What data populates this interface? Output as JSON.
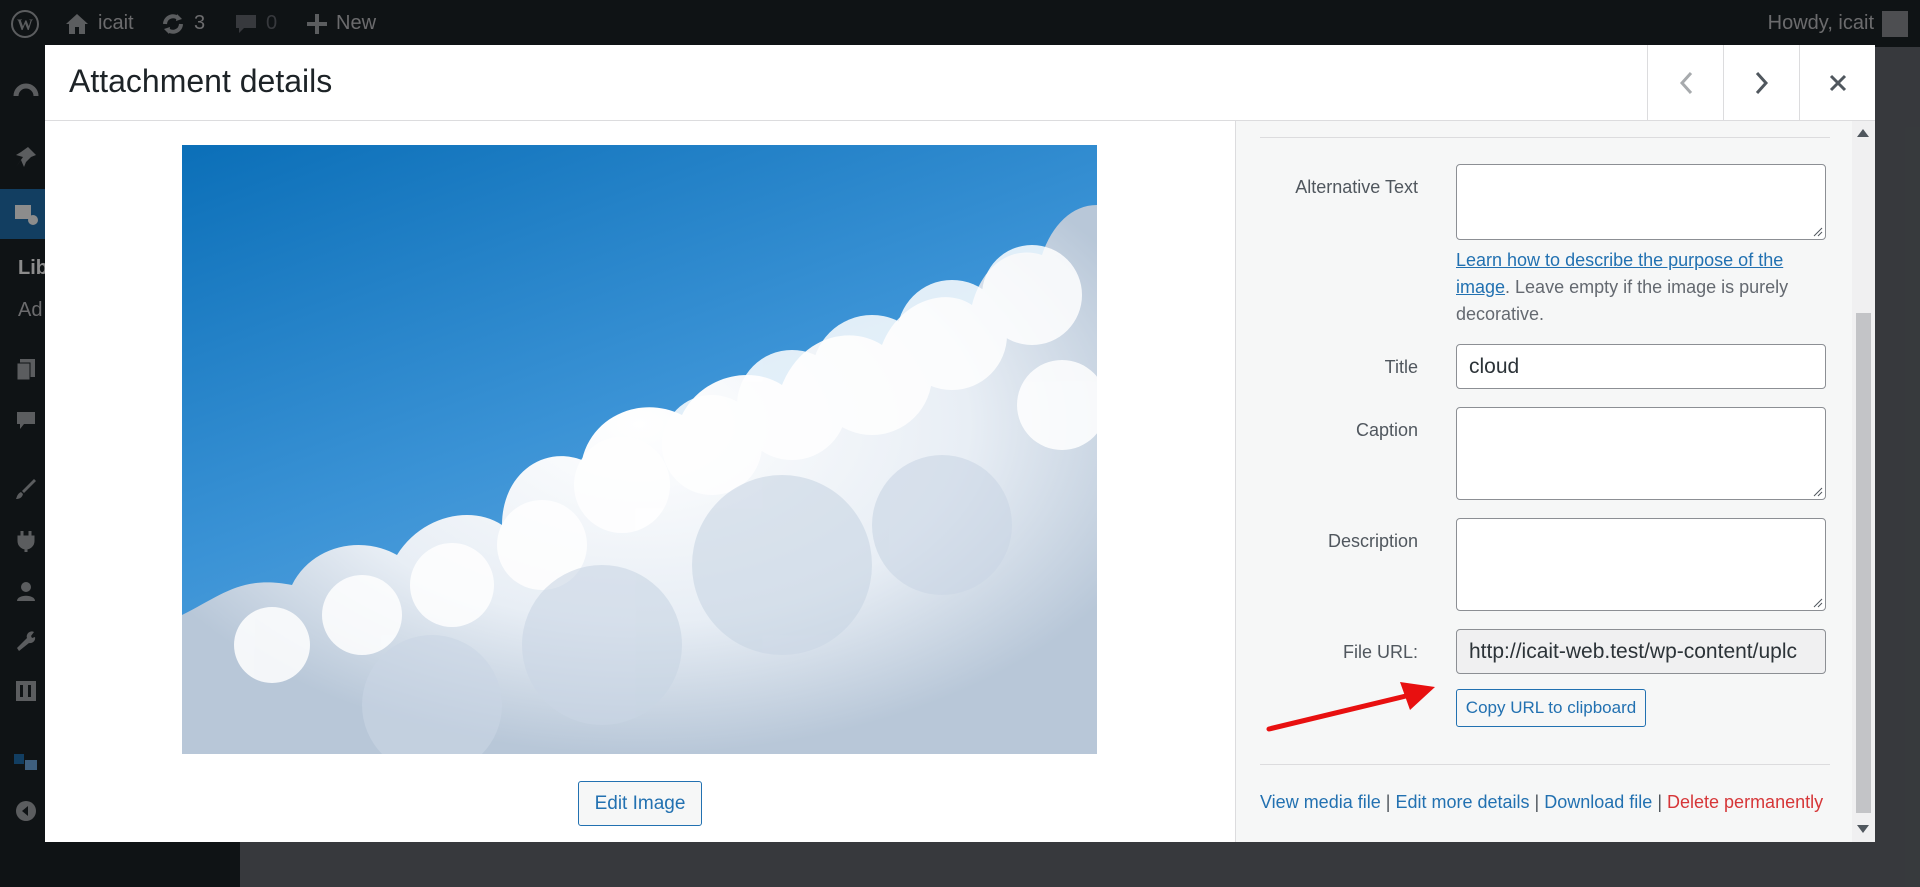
{
  "adminbar": {
    "site_name": "icait",
    "updates_count": "3",
    "comments_count": "0",
    "new_label": "New",
    "howdy": "Howdy, icait"
  },
  "sidebar": {
    "library_label": "Lib",
    "add_label": "Ad"
  },
  "modal": {
    "title": "Attachment details",
    "edit_image_label": "Edit Image",
    "fields": {
      "alt_label": "Alternative Text",
      "alt_value": "",
      "help_link": "Learn how to describe the purpose of the image",
      "help_rest": ". Leave empty if the image is purely decorative.",
      "title_label": "Title",
      "title_value": "cloud",
      "caption_label": "Caption",
      "caption_value": "",
      "description_label": "Description",
      "description_value": "",
      "file_url_label": "File URL:",
      "file_url_value": "http://icait-web.test/wp-content/uplc"
    },
    "copy_url_label": "Copy URL to clipboard",
    "actions": {
      "view": "View media file",
      "edit_more": "Edit more details",
      "download": "Download file",
      "delete": "Delete permanently",
      "sep": "|"
    }
  },
  "colors": {
    "accent": "#2271b1",
    "danger": "#d63638",
    "annotation_arrow": "#e81010"
  }
}
